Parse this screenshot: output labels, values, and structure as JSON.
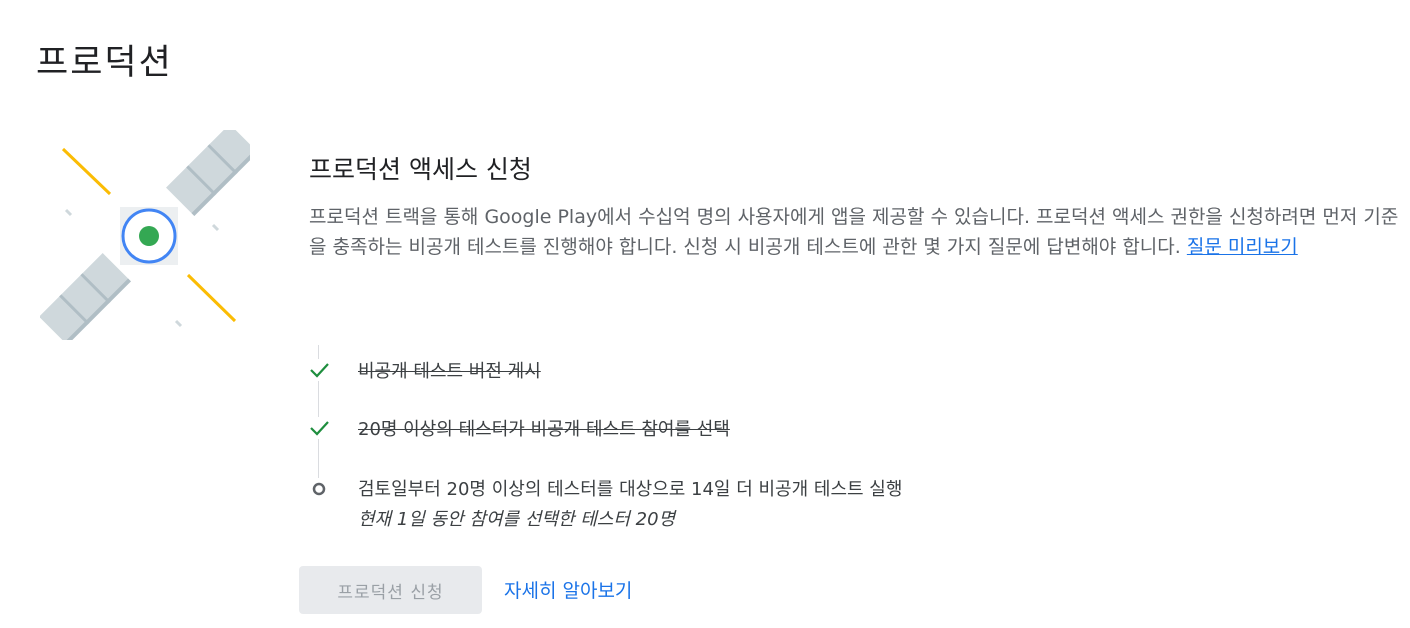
{
  "page": {
    "title": "프로덕션"
  },
  "card": {
    "title": "프로덕션 액세스 신청",
    "description": "프로덕션 트랙을 통해 Google Play에서 수십억 명의 사용자에게 앱을 제공할 수 있습니다. 프로덕션 액세스 권한을 신청하려면 먼저 기준을 충족하는 비공개 테스트를 진행해야 합니다. 신청 시 비공개 테스트에 관한 몇 가지 질문에 답변해야 합니다.",
    "preview_link": "질문 미리보기"
  },
  "steps": [
    {
      "label": "비공개 테스트 버전 게시",
      "status": "complete",
      "icon": "check-icon"
    },
    {
      "label": "20명 이상의 테스터가 비공개 테스트 참여를 선택",
      "status": "complete",
      "icon": "check-icon"
    },
    {
      "label": "검토일부터 20명 이상의 테스터를 대상으로 14일 더 비공개 테스트 실행",
      "sublabel": "현재 1일 동안 참여를 선택한 테스터 20명",
      "status": "pending",
      "icon": "circle-outline-icon"
    }
  ],
  "actions": {
    "apply_label": "프로덕션 신청",
    "apply_enabled": false,
    "learn_more_label": "자세히 알아보기"
  },
  "colors": {
    "check": "#1e8e3e",
    "link": "#1a73e8",
    "satellite_ring": "#4285f4",
    "satellite_core": "#34a853",
    "accent_lines": "#fbbc04",
    "panels": "#cfd8dc"
  }
}
